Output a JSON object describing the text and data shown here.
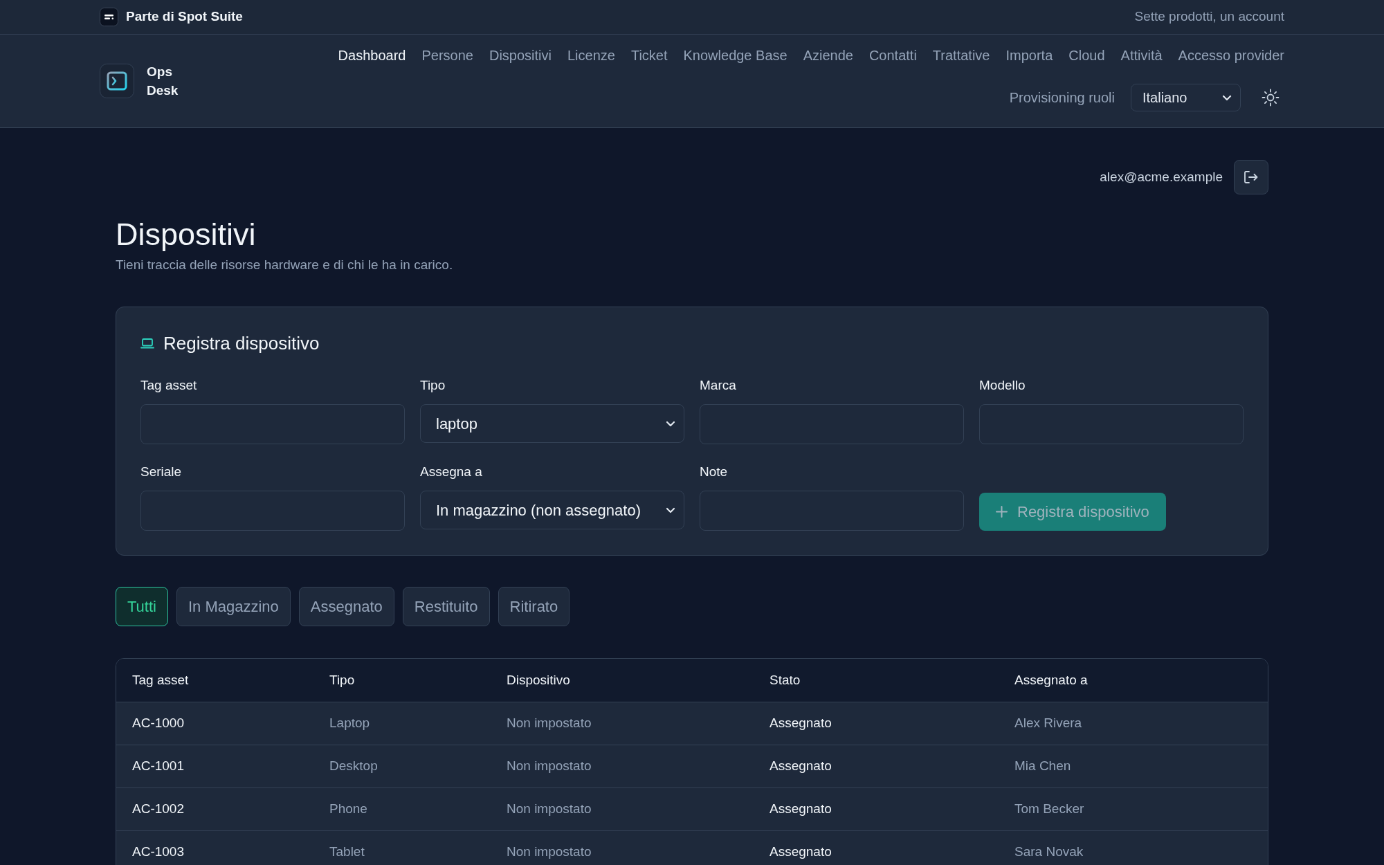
{
  "suite_bar": {
    "title": "Parte di Spot Suite",
    "tagline": "Sette prodotti, un account"
  },
  "header": {
    "brand": "Ops Desk",
    "nav": [
      {
        "label": "Dashboard",
        "selected": true
      },
      {
        "label": "Persone",
        "selected": false
      },
      {
        "label": "Dispositivi",
        "selected": false
      },
      {
        "label": "Licenze",
        "selected": false
      },
      {
        "label": "Ticket",
        "selected": false
      },
      {
        "label": "Knowledge Base",
        "selected": false
      },
      {
        "label": "Aziende",
        "selected": false
      },
      {
        "label": "Contatti",
        "selected": false
      },
      {
        "label": "Trattative",
        "selected": false
      },
      {
        "label": "Importa",
        "selected": false
      },
      {
        "label": "Cloud",
        "selected": false
      },
      {
        "label": "Attività",
        "selected": false
      },
      {
        "label": "Accesso provider",
        "selected": false
      }
    ],
    "role_link": "Provisioning ruoli",
    "language": "Italiano"
  },
  "user": {
    "email": "alex@acme.example"
  },
  "page": {
    "title": "Dispositivi",
    "subtitle": "Tieni traccia delle risorse hardware e di chi le ha in carico."
  },
  "form": {
    "title": "Registra dispositivo",
    "fields": [
      {
        "label": "Tag asset",
        "kind": "text"
      },
      {
        "label": "Tipo",
        "kind": "select",
        "value": "laptop"
      },
      {
        "label": "Marca",
        "kind": "text"
      },
      {
        "label": "Modello",
        "kind": "text"
      },
      {
        "label": "Seriale",
        "kind": "text"
      },
      {
        "label": "Assegna a",
        "kind": "select",
        "value": "In magazzino (non assegnato)"
      },
      {
        "label": "Note",
        "kind": "text"
      }
    ],
    "submit": {
      "label": "Registra dispositivo",
      "disabled": true
    }
  },
  "filters": [
    {
      "label": "Tutti",
      "selected": true
    },
    {
      "label": "In Magazzino",
      "selected": false
    },
    {
      "label": "Assegnato",
      "selected": false
    },
    {
      "label": "Restituito",
      "selected": false
    },
    {
      "label": "Ritirato",
      "selected": false
    }
  ],
  "table": {
    "columns": [
      "Tag asset",
      "Tipo",
      "Dispositivo",
      "Stato",
      "Assegnato a"
    ],
    "rows": [
      [
        "AC-1000",
        "Laptop",
        "Non impostato",
        "Assegnato",
        "Alex Rivera"
      ],
      [
        "AC-1001",
        "Desktop",
        "Non impostato",
        "Assegnato",
        "Mia Chen"
      ],
      [
        "AC-1002",
        "Phone",
        "Non impostato",
        "Assegnato",
        "Tom Becker"
      ],
      [
        "AC-1003",
        "Tablet",
        "Non impostato",
        "Assegnato",
        "Sara Novak"
      ]
    ]
  }
}
